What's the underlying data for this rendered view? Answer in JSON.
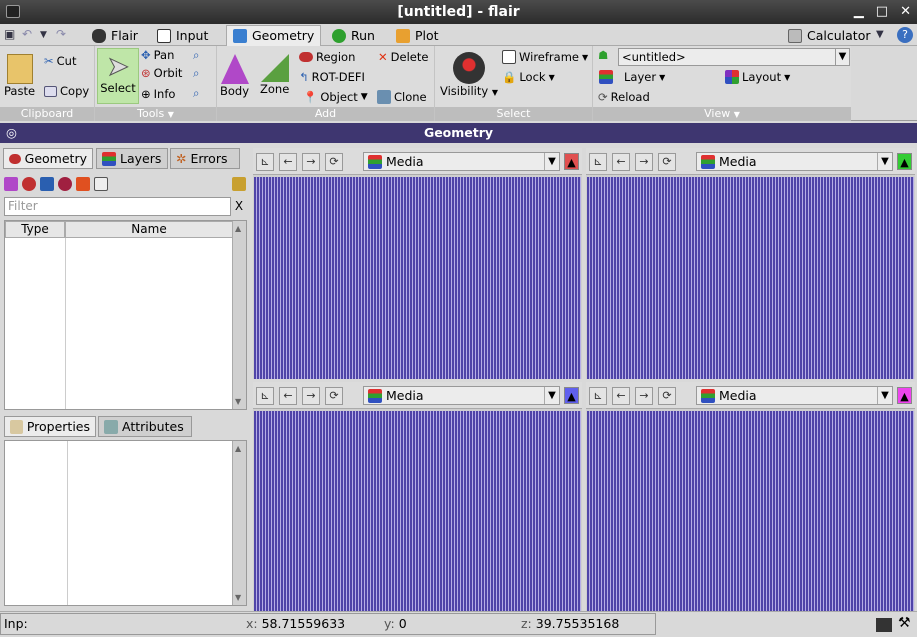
{
  "window": {
    "title": "[untitled] - flair",
    "min_icon": "minimize-icon",
    "max_icon": "maximize-icon",
    "close_icon": "close-icon",
    "min_glyph": "▁",
    "max_glyph": "□",
    "close_glyph": "✕"
  },
  "tabs": [
    {
      "label": "Flair",
      "icon": "flair-pot-icon"
    },
    {
      "label": "Input",
      "icon": "input-icon"
    },
    {
      "label": "Geometry",
      "icon": "geometry-icon"
    },
    {
      "label": "Run",
      "icon": "run-icon"
    },
    {
      "label": "Plot",
      "icon": "plot-icon"
    }
  ],
  "calculator": {
    "label": "Calculator",
    "arrow": "▼",
    "help": "?"
  },
  "ribbon": {
    "clipboard": {
      "label": "Clipboard",
      "paste": "Paste",
      "cut": "Cut",
      "copy": "Copy"
    },
    "tools": {
      "label": "Tools",
      "label_arrow": "▼",
      "select": "Select",
      "pan": "Pan",
      "orbit": "Orbit",
      "info": "Info"
    },
    "add": {
      "label": "Add",
      "body": "Body",
      "zone": "Zone",
      "region": "Region",
      "rotdefi": "ROT-DEFI",
      "object": "Object",
      "object_arrow": "▼",
      "delete": "Delete",
      "clone": "Clone"
    },
    "select": {
      "label": "Select",
      "visibility": "Visibility",
      "visibility_arrow": "▼",
      "wireframe": "Wireframe",
      "wireframe_arrow": "▼",
      "lock": "Lock",
      "lock_arrow": "▼"
    },
    "view": {
      "label": "View",
      "label_arrow": "▼",
      "project": "<untitled>",
      "layer": "Layer",
      "layer_arrow": "▼",
      "layout": "Layout",
      "layout_arrow": "▼",
      "reload": "Reload"
    }
  },
  "dock": {
    "title": "Geometry",
    "left_icon": "◎",
    "float_icon": "▲",
    "close_icon": "✕"
  },
  "left": {
    "tabs": [
      "Geometry",
      "Layers",
      "Errors"
    ],
    "filter_placeholder": "Filter",
    "filter_clear": "X",
    "columns": [
      "Type",
      "Name"
    ],
    "bottom_tabs": [
      "Properties",
      "Attributes"
    ]
  },
  "viewports": [
    {
      "combo": "Media",
      "marker_color": "#e05050",
      "marker": "▲"
    },
    {
      "combo": "Media",
      "marker_color": "#33cc33",
      "marker": "▲"
    },
    {
      "combo": "Media",
      "marker_color": "#6060ee",
      "marker": "▲"
    },
    {
      "combo": "Media",
      "marker_color": "#ee44ee",
      "marker": "▲"
    }
  ],
  "status": {
    "inp": "Inp:",
    "x_label": "x:",
    "x": "58.71559633",
    "y_label": "y:",
    "y": "0",
    "z_label": "z:",
    "z": "39.75535168"
  }
}
